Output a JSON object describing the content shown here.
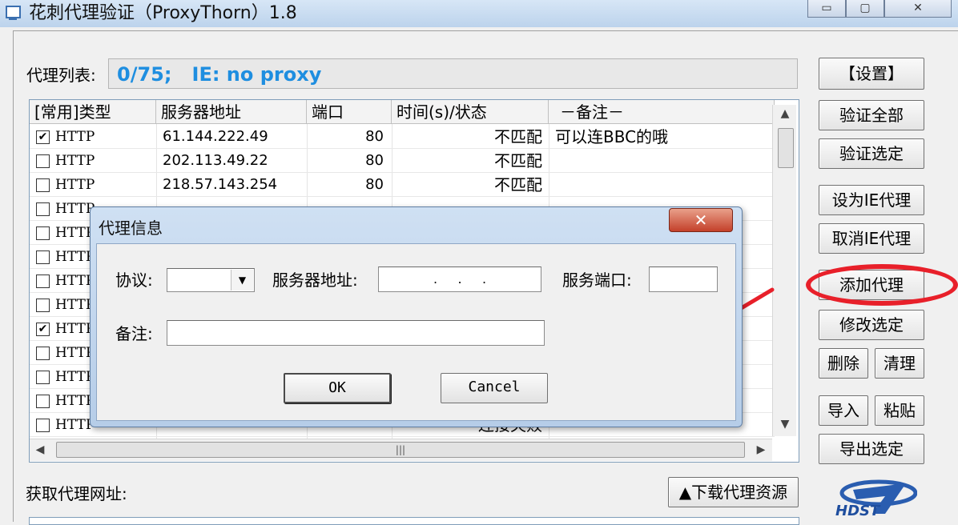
{
  "window": {
    "title": "花刺代理验证（ProxyThorn）1.8",
    "caption_buttons": [
      "▭",
      "▢",
      "✕"
    ]
  },
  "proxy_list": {
    "label": "代理列表:",
    "status": "0/75;   IE: no proxy",
    "columns": [
      "[常用]类型",
      "服务器地址",
      "端口",
      "时间(s)/状态",
      "－备注－"
    ],
    "rows": [
      {
        "checked": true,
        "type": "HTTP",
        "address": "61.144.222.49",
        "port": "80",
        "status": "不匹配",
        "note": "可以连BBC的哦"
      },
      {
        "checked": false,
        "type": "HTTP",
        "address": "202.113.49.22",
        "port": "80",
        "status": "不匹配",
        "note": ""
      },
      {
        "checked": false,
        "type": "HTTP",
        "address": "218.57.143.254",
        "port": "80",
        "status": "不匹配",
        "note": ""
      },
      {
        "checked": false,
        "type": "HTTP",
        "address": "",
        "port": "",
        "status": "",
        "note": ""
      },
      {
        "checked": false,
        "type": "HTTP",
        "address": "",
        "port": "",
        "status": "",
        "note": ""
      },
      {
        "checked": false,
        "type": "HTTP",
        "address": "",
        "port": "",
        "status": "",
        "note": ""
      },
      {
        "checked": false,
        "type": "HTTP",
        "address": "",
        "port": "",
        "status": "",
        "note": ""
      },
      {
        "checked": false,
        "type": "HTTP",
        "address": "",
        "port": "",
        "status": "",
        "note": ""
      },
      {
        "checked": true,
        "type": "HTTP",
        "address": "",
        "port": "",
        "status": "",
        "note": ""
      },
      {
        "checked": false,
        "type": "HTTP",
        "address": "",
        "port": "",
        "status": "",
        "note": ""
      },
      {
        "checked": false,
        "type": "HTTP",
        "address": "",
        "port": "",
        "status": "",
        "note": ""
      },
      {
        "checked": false,
        "type": "HTTP",
        "address": "",
        "port": "",
        "status": "",
        "note": ""
      },
      {
        "checked": false,
        "type": "HTTP",
        "address": "",
        "port": "",
        "status": "连接失败",
        "note": ""
      }
    ]
  },
  "buttons": {
    "settings": "【设置】",
    "verify_all": "验证全部",
    "verify_selected": "验证选定",
    "set_ie_proxy": "设为IE代理",
    "cancel_ie_proxy": "取消IE代理",
    "add_proxy": "添加代理",
    "modify_selected": "修改选定",
    "delete": "删除",
    "clean": "清理",
    "import": "导入",
    "paste": "粘贴",
    "export_selected": "导出选定"
  },
  "fetch": {
    "label": "获取代理网址:",
    "download_button": "▲下载代理资源"
  },
  "logo": {
    "text": "HDST"
  },
  "dialog": {
    "title": "代理信息",
    "close": "✕",
    "protocol_label": "协议:",
    "protocol_value": "",
    "server_label": "服务器地址:",
    "server_value": ".     .     .",
    "port_label": "服务端口:",
    "port_value": "",
    "note_label": "备注:",
    "note_value": "",
    "ok": "OK",
    "cancel": "Cancel"
  },
  "colors": {
    "status_text": "#1e8ee0",
    "annotation_red": "#e8202a"
  }
}
